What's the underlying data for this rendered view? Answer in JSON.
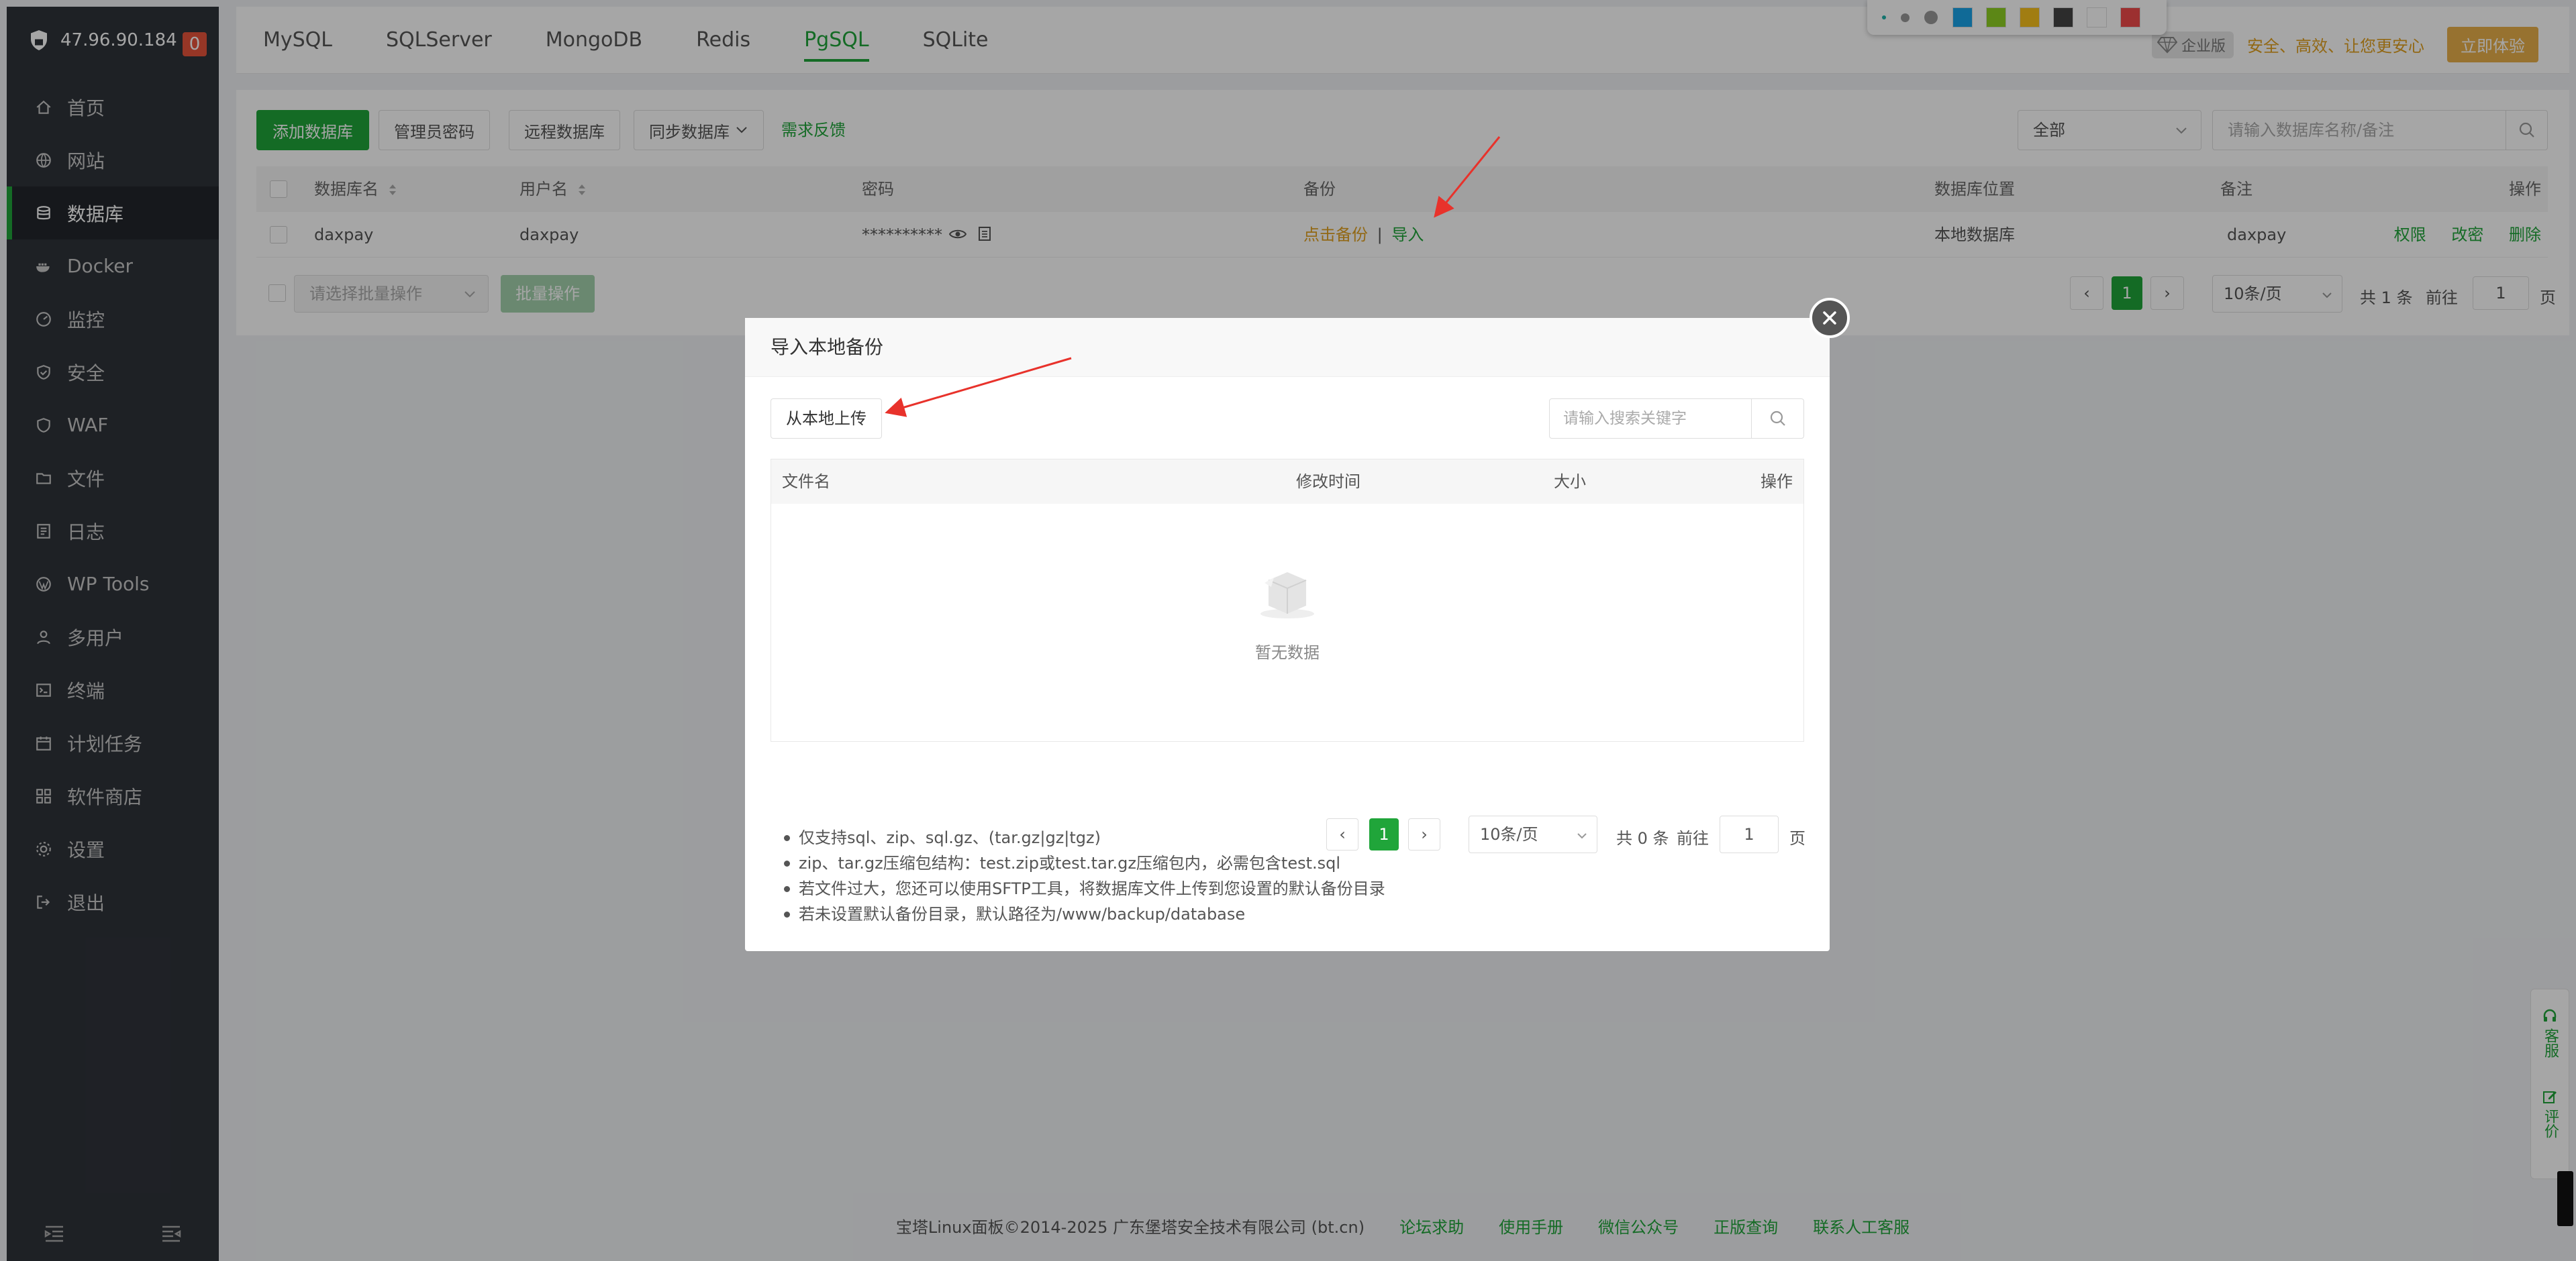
{
  "sidebar": {
    "ip": "47.96.90.184",
    "badge": "0",
    "items": [
      {
        "label": "首页",
        "icon": "home-icon"
      },
      {
        "label": "网站",
        "icon": "globe-icon"
      },
      {
        "label": "数据库",
        "icon": "database-icon"
      },
      {
        "label": "Docker",
        "icon": "docker-icon"
      },
      {
        "label": "监控",
        "icon": "monitor-icon"
      },
      {
        "label": "安全",
        "icon": "shield-icon"
      },
      {
        "label": "WAF",
        "icon": "waf-icon"
      },
      {
        "label": "文件",
        "icon": "folder-icon"
      },
      {
        "label": "日志",
        "icon": "log-icon"
      },
      {
        "label": "WP Tools",
        "icon": "wordpress-icon"
      },
      {
        "label": "多用户",
        "icon": "users-icon"
      },
      {
        "label": "终端",
        "icon": "terminal-icon"
      },
      {
        "label": "计划任务",
        "icon": "calendar-icon"
      },
      {
        "label": "软件商店",
        "icon": "store-icon"
      },
      {
        "label": "设置",
        "icon": "gear-icon"
      },
      {
        "label": "退出",
        "icon": "logout-icon"
      }
    ]
  },
  "topbar": {
    "tabs": [
      "MySQL",
      "SQLServer",
      "MongoDB",
      "Redis",
      "PgSQL",
      "SQLite"
    ],
    "active_tab": "PgSQL",
    "enterprise_badge": "企业版",
    "slogan": "安全、高效、让您更安心",
    "try_button": "立即体验"
  },
  "color_toolbar": {
    "swatches": [
      "#1aa3e8",
      "#8ed022",
      "#f8c01c",
      "#444444",
      "#ffffff",
      "#f04b4b"
    ]
  },
  "toolbar": {
    "add_db": "添加数据库",
    "admin_password": "管理员密码",
    "remote_db": "远程数据库",
    "sync_db": "同步数据库",
    "feedback": "需求反馈",
    "filter_value": "全部",
    "search_placeholder": "请输入数据库名称/备注"
  },
  "table": {
    "headers": {
      "name": "数据库名",
      "user": "用户名",
      "password": "密码",
      "backup": "备份",
      "location": "数据库位置",
      "note": "备注",
      "actions": "操作"
    },
    "row": {
      "name": "daxpay",
      "user": "daxpay",
      "password": "**********",
      "backup_link": "点击备份",
      "separator": "|",
      "import_link": "导入",
      "location": "本地数据库",
      "note": "daxpay",
      "perm": "权限",
      "change_pw": "改密",
      "delete": "删除"
    }
  },
  "batch": {
    "select_placeholder": "请选择批量操作",
    "button": "批量操作"
  },
  "pager": {
    "page": "1",
    "per_page": "10条/页",
    "total": "共 1 条",
    "goto": "前往",
    "goto_value": "1",
    "page_unit": "页"
  },
  "modal": {
    "title": "导入本地备份",
    "upload_button": "从本地上传",
    "search_placeholder": "请输入搜索关键字",
    "columns": {
      "filename": "文件名",
      "modified": "修改时间",
      "size": "大小",
      "actions": "操作"
    },
    "empty_text": "暂无数据",
    "pager": {
      "page": "1",
      "per_page": "10条/页",
      "total": "共 0 条",
      "goto": "前往",
      "goto_value": "1",
      "page_unit": "页"
    },
    "notes": [
      "仅支持sql、zip、sql.gz、(tar.gz|gz|tgz)",
      "zip、tar.gz压缩包结构：test.zip或test.tar.gz压缩包内，必需包含test.sql",
      "若文件过大，您还可以使用SFTP工具，将数据库文件上传到您设置的默认备份目录",
      "若未设置默认备份目录，默认路径为/www/backup/database"
    ]
  },
  "footer": {
    "copyright": "宝塔Linux面板©2014-2025 广东堡塔安全技术有限公司 (bt.cn)",
    "links": [
      "论坛求助",
      "使用手册",
      "微信公众号",
      "正版查询",
      "联系人工客服"
    ]
  },
  "side_float": {
    "service": "客服",
    "review": "评价"
  }
}
